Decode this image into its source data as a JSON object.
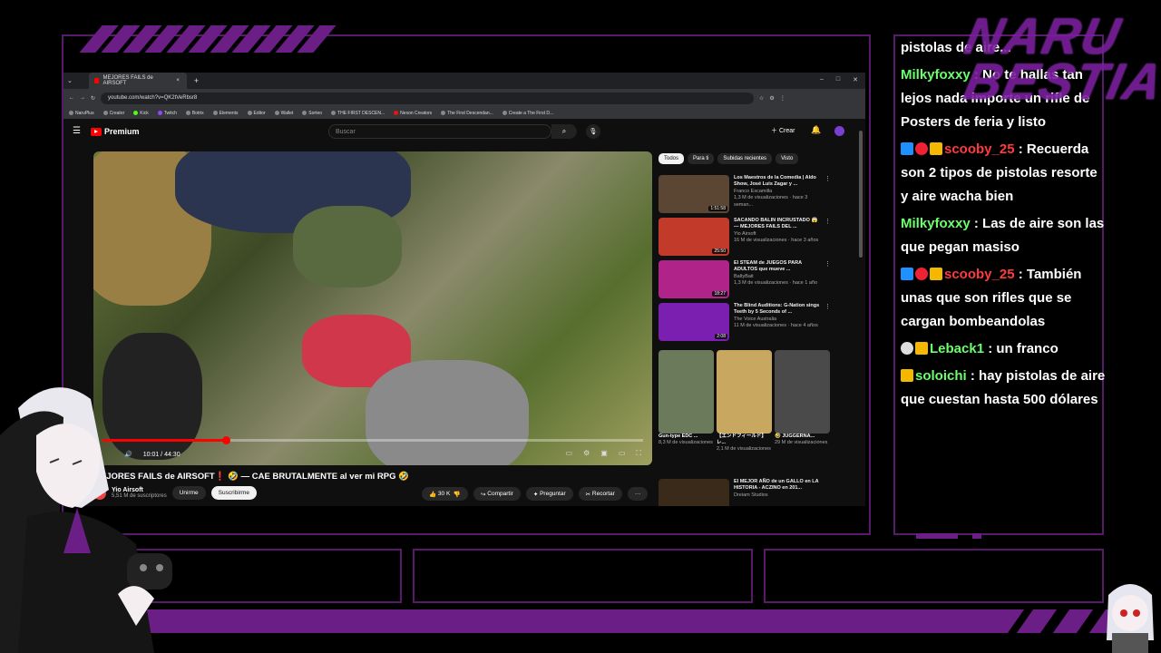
{
  "browser": {
    "tab_title": "MEJORES FAILS de AIRSOFT",
    "tab_close": "×",
    "new_tab": "+",
    "window_buttons": [
      "–",
      "□",
      "✕"
    ],
    "url": "youtube.com/watch?v=QK2tVeRbsr8",
    "bookmarks": [
      "NaruPlus",
      "Creator",
      "Kick",
      "Twitch",
      "Botrix",
      "Elements",
      "Editor",
      "Wallet",
      "Sorteo",
      "THE FIRST DESCEN...",
      "Nexon Creators",
      "The First Descendan...",
      "Create a The First D..."
    ]
  },
  "youtube": {
    "logo": "Premium",
    "search_placeholder": "Buscar",
    "create_label": "Crear",
    "video": {
      "time": "10:01 / 44:30",
      "progress": 0.229,
      "title": "MEJORES FAILS de AIRSOFT❗ 🤣 — CAE BRUTALMENTE al ver mi RPG 🤣",
      "channel": "Yio Airsoft",
      "subscribers": "5,51 M de suscriptores",
      "join": "Unirme",
      "subscribe": "Suscribirme",
      "likes": "30 K",
      "share": "Compartir",
      "ask": "Preguntar",
      "clip": "Recortar"
    },
    "chips": [
      "Todos",
      "Para ti",
      "Subidas recientes",
      "Visto"
    ],
    "recommended": [
      {
        "title": "Los Maestros de la Comedia | Aldo Show, José Luis Zagar y ...",
        "channel": "Franco Escamilla",
        "meta": "1,3 M de visualizaciones · hace 3 seman...",
        "duration": "1:51:58",
        "color": "#5a4632"
      },
      {
        "title": "SACANDO BALIN INCRUSTADO 😱 — MEJORES FAILS DEL ...",
        "channel": "Yio Airsoft",
        "meta": "16 M de visualizaciones · hace 3 años",
        "duration": "25:50",
        "color": "#c23a2a"
      },
      {
        "title": "El STEAM de JUEGOS PARA ADULTOS que mueve ...",
        "channel": "BaltyBait",
        "meta": "1,3 M de visualizaciones · hace 1 año",
        "duration": "18:27",
        "color": "#b0248a"
      },
      {
        "title": "The Blind Auditions: G-Nation sings Teeth by 5 Seconds of ...",
        "channel": "The Voice Australia",
        "meta": "11 M de visualizaciones · hace 4 años",
        "duration": "2:08",
        "color": "#7a1fb0"
      }
    ],
    "shorts": [
      {
        "title": "Gun-type EDC ...",
        "views": "8,3 M de visualizaciones",
        "color": "#6a7a5a"
      },
      {
        "title": "【エンドフィールド】レ...",
        "views": "2,1 M de visualizaciones",
        "color": "#c8a860"
      },
      {
        "title": "🤣 JUGGERNA...",
        "views": "29 M de visualizaciones",
        "color": "#4a4a4a"
      }
    ],
    "next": {
      "title": "El MEJOR AÑO de un GALLO en LA HISTORIA - ACZINO en 201...",
      "channel": "Dreiam Studios",
      "color": "#3a2a1a"
    }
  },
  "chat": {
    "messages": [
      {
        "user": "",
        "text": "pistolas de aire..."
      },
      {
        "user": "Milkyfoxxy",
        "text": "No te hallas tan lejos nada importe un rifle de Posters de feria y listo",
        "color": "green"
      },
      {
        "user": "scooby_25",
        "text": "Recuerda son 2 tipos de pistolas resorte y aire wacha bien",
        "color": "red"
      },
      {
        "user": "Milkyfoxxy",
        "text": "Las de aire son las que pegan masiso",
        "color": "green"
      },
      {
        "user": "scooby_25",
        "text": "También unas que son rifles que se cargan bombeandolas",
        "color": "red"
      },
      {
        "user": "Leback1",
        "text": "un franco",
        "color": "green"
      },
      {
        "user": "soloichi",
        "text": "hay pistolas de aire que cuestan hasta 500 dólares",
        "color": "green"
      }
    ]
  },
  "brand": {
    "line1": "NARU",
    "line2": "BESTIA"
  }
}
